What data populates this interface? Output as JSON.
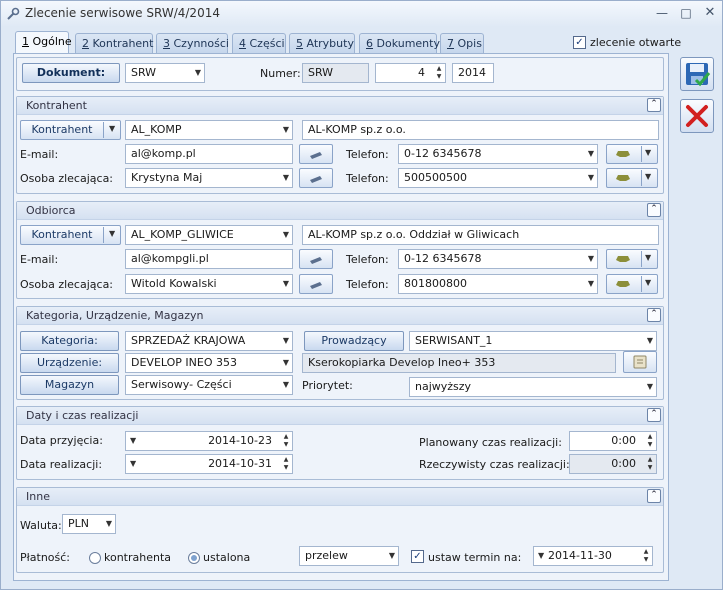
{
  "window": {
    "title": "Zlecenie serwisowe SRW/4/2014"
  },
  "tabs": [
    {
      "key": "1",
      "label": " Ogólne"
    },
    {
      "key": "2",
      "label": " Kontrahent"
    },
    {
      "key": "3",
      "label": " Czynności"
    },
    {
      "key": "4",
      "label": " Części"
    },
    {
      "key": "5",
      "label": " Atrybuty"
    },
    {
      "key": "6",
      "label": " Dokumenty"
    },
    {
      "key": "7",
      "label": " Opis"
    }
  ],
  "zlecenie_otwarte": {
    "label": "zlecenie otwarte",
    "checked": true
  },
  "dokument": {
    "button": "Dokument:",
    "type": "SRW",
    "numer_label": "Numer:",
    "numer_prefix": "SRW",
    "numer_value": "4",
    "year": "2014"
  },
  "kontrahent": {
    "title": "Kontrahent",
    "button": "Kontrahent",
    "code": "AL_KOMP",
    "name": "AL-KOMP sp.z o.o.",
    "email_label": "E-mail:",
    "email": "al@komp.pl",
    "phone_label": "Telefon:",
    "phone1": "0-12 6345678",
    "person_label": "Osoba zlecająca:",
    "person": "Krystyna Maj",
    "phone2_label": "Telefon:",
    "phone2": "500500500"
  },
  "odbiorca": {
    "title": "Odbiorca",
    "button": "Kontrahent",
    "code": "AL_KOMP_GLIWICE",
    "name": "AL-KOMP sp.z o.o. Oddział w Gliwicach",
    "email_label": "E-mail:",
    "email": "al@kompgli.pl",
    "phone_label": "Telefon:",
    "phone1": "0-12 6345678",
    "person_label": "Osoba zlecająca:",
    "person": "Witold Kowalski",
    "phone2_label": "Telefon:",
    "phone2": "801800800"
  },
  "kategoria": {
    "title": "Kategoria, Urządzenie, Magazyn",
    "kategoria_button": "Kategoria:",
    "kategoria_value": "SPRZEDAŻ KRAJOWA",
    "prowadzacy_button": "Prowadzący",
    "prowadzacy_value": "SERWISANT_1",
    "urzadzenie_button": "Urządzenie:",
    "urzadzenie_value": "DEVELOP INEO 353",
    "urzadzenie_desc": "Kserokopiarka Develop Ineo+ 353",
    "magazyn_button": "Magazyn",
    "magazyn_value": "Serwisowy- Części",
    "priorytet_label": "Priorytet:",
    "priorytet_value": "najwyższy"
  },
  "daty": {
    "title": "Daty i czas realizacji",
    "przyjecia_label": "Data przyjęcia:",
    "przyjecia_value": "2014-10-23",
    "realizacji_label": "Data realizacji:",
    "realizacji_value": "2014-10-31",
    "planowany_label": "Planowany czas realizacji:",
    "planowany_value": "0:00",
    "rzeczywisty_label": "Rzeczywisty czas realizacji:",
    "rzeczywisty_value": "0:00"
  },
  "inne": {
    "title": "Inne",
    "waluta_label": "Waluta:",
    "waluta_value": "PLN",
    "platnosc_label": "Płatność:",
    "opt_kontrahenta": "kontrahenta",
    "opt_ustalona": "ustalona",
    "selected": "ustalona",
    "forma": "przelew",
    "termin_label": "ustaw termin na:",
    "termin_checked": true,
    "termin_value": "2014-11-30"
  },
  "colors": {
    "accent": "#1c3a66",
    "save": "#1e5aa8",
    "cancel": "#d22020"
  }
}
